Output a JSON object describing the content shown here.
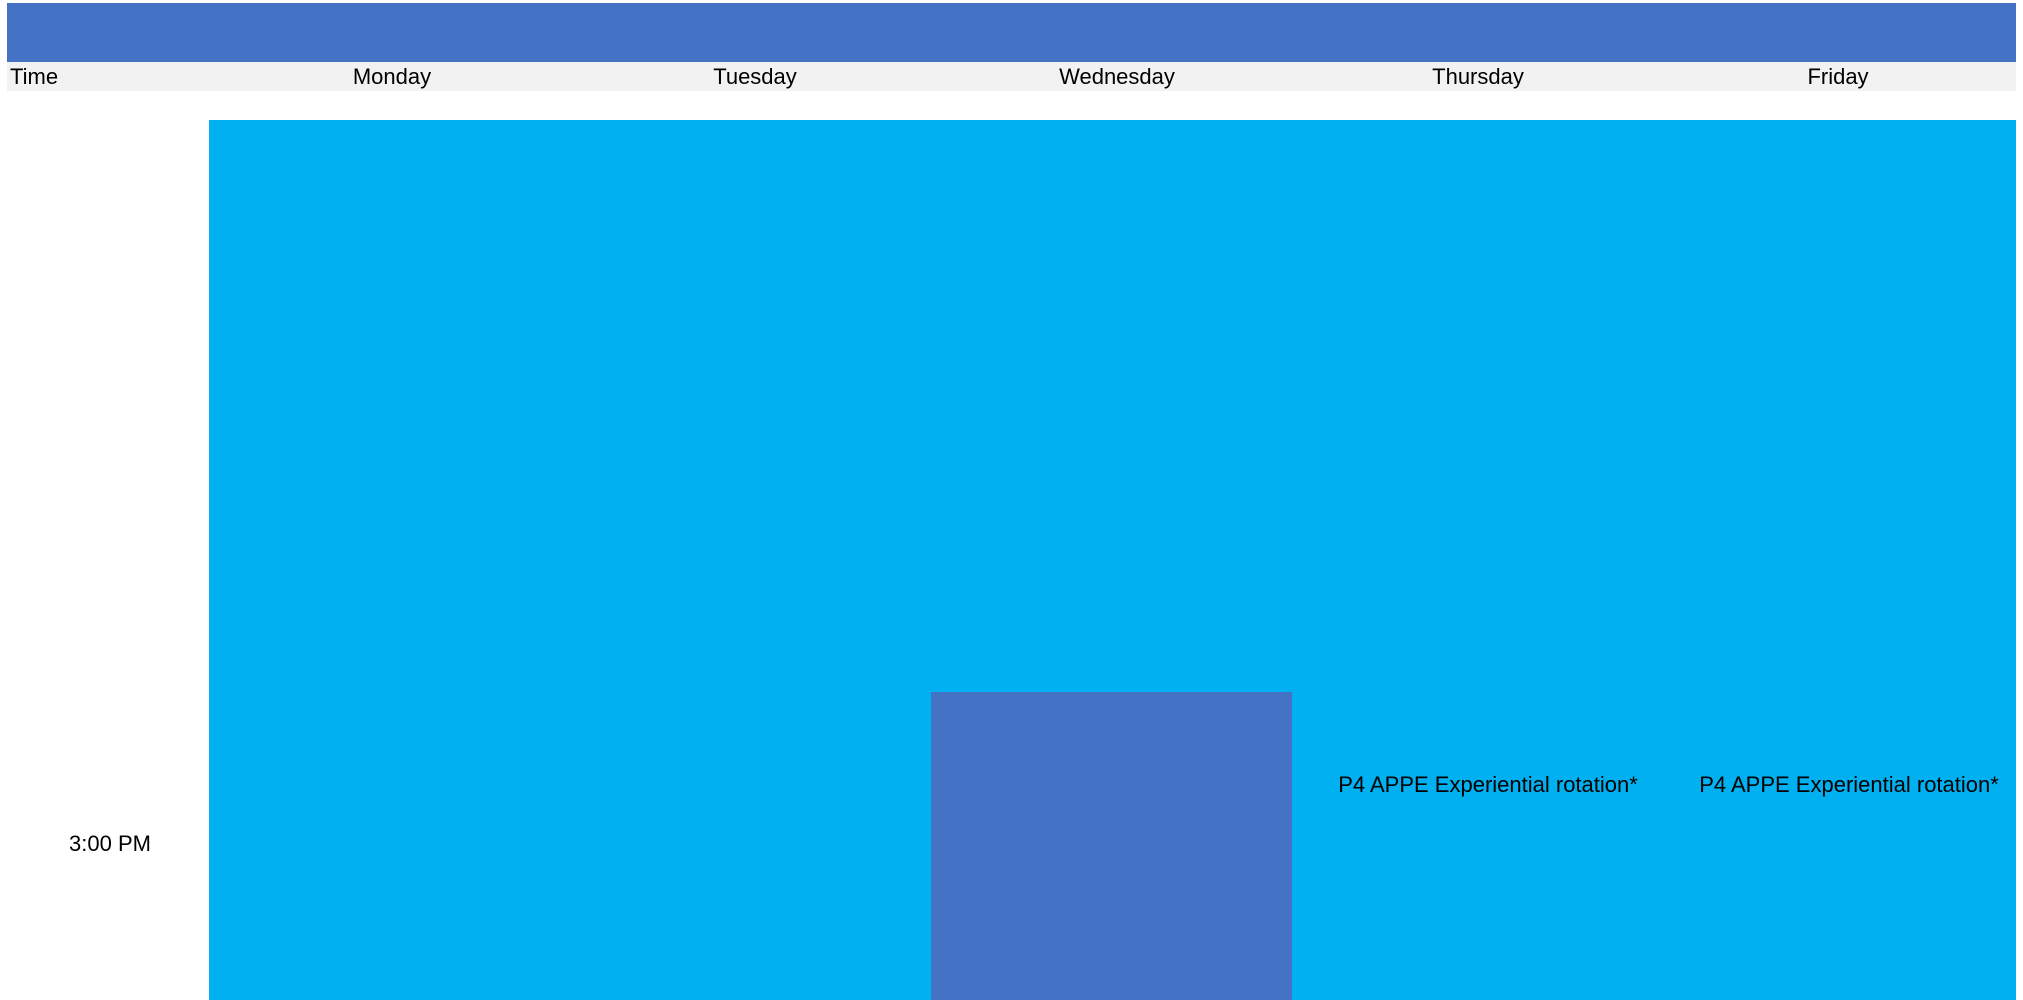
{
  "header": {
    "time_label": "Time",
    "days": [
      "Monday",
      "Tuesday",
      "Wednesday",
      "Thursday",
      "Friday"
    ]
  },
  "schedule": {
    "time_slots": [
      "3:00 PM"
    ],
    "events": {
      "thursday": "P4 APPE Experiential rotation*",
      "friday": "P4 APPE Experiential rotation*"
    }
  },
  "colors": {
    "banner": "#4472c4",
    "header_row": "#f2f2f2",
    "event_block": "#00b0f0",
    "wednesday_block": "#4472c4"
  }
}
